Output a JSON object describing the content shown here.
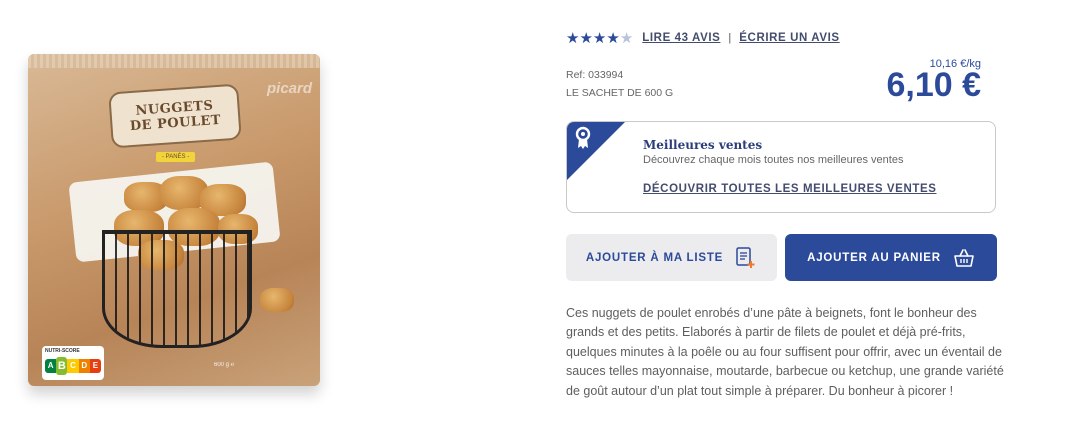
{
  "product": {
    "image": {
      "label_line1": "NUGGETS",
      "label_line2": "DE POULET",
      "tag": "- PANÉS -",
      "brand": "picard",
      "nutri_score_title": "NUTRI-SCORE",
      "nutri_score_letters": [
        "A",
        "B",
        "C",
        "D",
        "E"
      ],
      "nutri_score_value": "B",
      "weight_text": "600 g ℮"
    },
    "rating": {
      "stars": 4,
      "max_stars": 5,
      "read_reviews": "LIRE 43 AVIS",
      "separator": "|",
      "write_review": "ÉCRIRE UN AVIS"
    },
    "ref": "Ref: 033994",
    "packaging": "LE SACHET DE 600 G",
    "price_per_kg": "10,16 €/kg",
    "price": "6,10 €",
    "best_sellers": {
      "title": "Meilleures ventes",
      "description": "Découvrez chaque mois toutes nos meilleures ventes",
      "link": "DÉCOUVRIR TOUTES LES MEILLEURES VENTES"
    },
    "buttons": {
      "add_to_list": "AJOUTER À MA LISTE",
      "add_to_cart": "AJOUTER AU PANIER"
    },
    "description": "Ces nuggets de poulet enrobés d’une pâte à beignets, font le bonheur des grands et des petits. Elaborés à partir de filets de poulet et déjà pré-frits, quelques minutes à la poêle ou au four suffisent pour offrir, avec un éventail de sauces telles mayonnaise, moutarde, barbecue ou ketchup, une grande variété de goût autour d’un plat tout simple à préparer. Du bonheur à picorer !"
  },
  "colors": {
    "brand_blue": "#2c4a9a",
    "nutri_a": "#038141",
    "nutri_b": "#85bb2f",
    "nutri_c": "#fecb02",
    "nutri_d": "#ee8100",
    "nutri_e": "#e63e11"
  }
}
